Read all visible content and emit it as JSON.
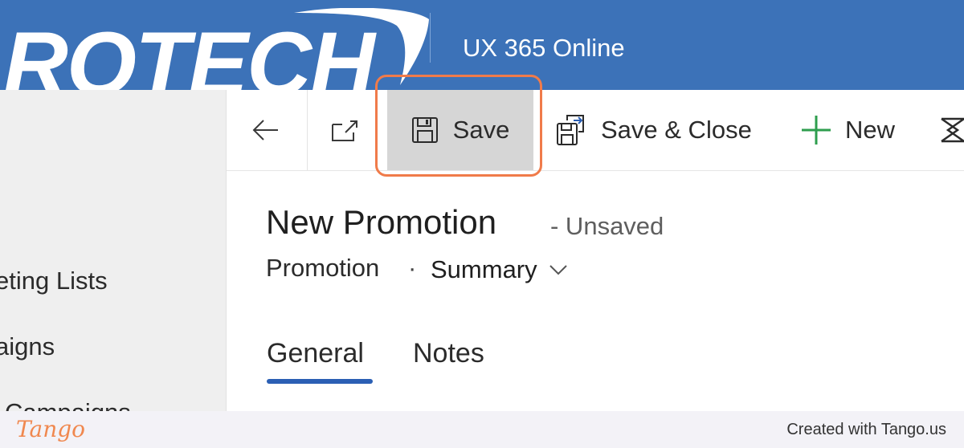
{
  "header": {
    "logo_text": "ROTECH",
    "app_name": "UX 365 Online",
    "background": "#3c72b8"
  },
  "sidebar": {
    "items": [
      {
        "label": "eting Lists"
      },
      {
        "label": "aigns"
      },
      {
        "label": "Campaigns"
      }
    ]
  },
  "command_bar": {
    "back_icon": "arrow-left-icon",
    "popout_icon": "open-in-new-window-icon",
    "save_label": "Save",
    "save_icon": "floppy-disk-icon",
    "save_close_label": "Save & Close",
    "save_close_icon": "save-close-icon",
    "new_label": "New",
    "new_icon": "plus-icon",
    "new_icon_color": "#2e9e4e",
    "flow_icon": "flow-icon"
  },
  "form": {
    "title": "New Promotion",
    "status": "- Unsaved",
    "entity": "Promotion",
    "separator": "·",
    "form_name": "Summary",
    "tabs": [
      {
        "label": "General",
        "active": true
      },
      {
        "label": "Notes",
        "active": false
      }
    ]
  },
  "highlight_color": "#f07b4a",
  "footer": {
    "brand": "Tango",
    "credit": "Created with Tango.us"
  }
}
